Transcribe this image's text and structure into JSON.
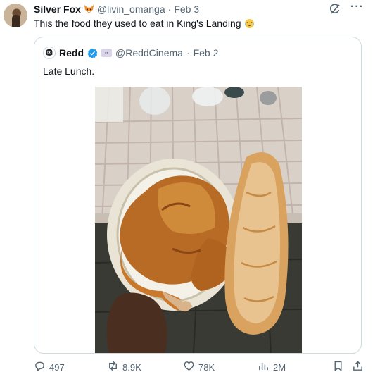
{
  "tweet": {
    "author_name": "Silver Fox",
    "author_handle": "@livin_omanga",
    "separator": "·",
    "date": "Feb 3",
    "text": "This the food they used to eat in King's Landing"
  },
  "quoted": {
    "author_name": "Redd",
    "author_handle": "@ReddCinema",
    "separator": "·",
    "date": "Feb 2",
    "text": "Late Lunch."
  },
  "actions": {
    "replies": "497",
    "reposts": "8.9K",
    "likes": "78K",
    "views": "2M"
  },
  "icons": {
    "grok": "grok-icon",
    "more": "more-icon",
    "reply": "reply-icon",
    "repost": "repost-icon",
    "like": "heart-icon",
    "views": "views-icon",
    "bookmark": "bookmark-icon",
    "share": "share-icon",
    "verified": "verified-icon"
  },
  "colors": {
    "verified_blue": "#1d9bf0",
    "secondary_text": "#536471"
  }
}
